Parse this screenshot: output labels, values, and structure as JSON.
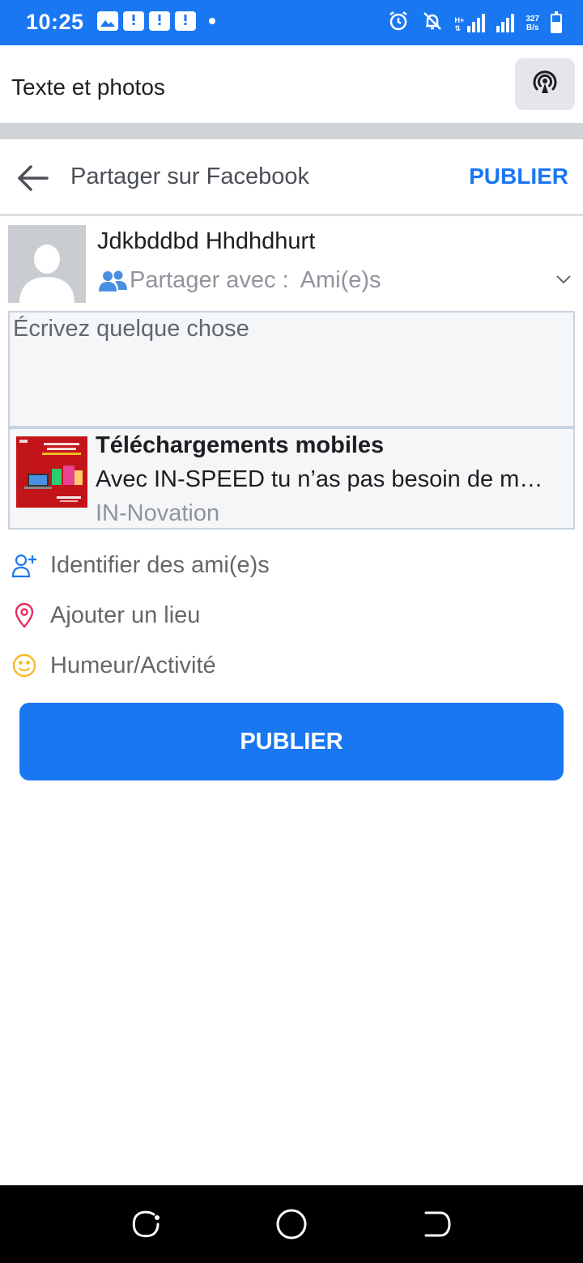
{
  "status_bar": {
    "time": "10:25",
    "network_type": "H+",
    "speed_value": "327",
    "speed_unit": "B/s",
    "notification_icons": [
      "image-icon",
      "message-alert-icon",
      "message-alert-icon",
      "message-alert-icon"
    ]
  },
  "app_bar": {
    "title": "Texte et photos",
    "action_icon": "broadcast-icon"
  },
  "header": {
    "back_icon": "arrow-left-icon",
    "title": "Partager sur Facebook",
    "publish_label": "PUBLIER"
  },
  "profile": {
    "name": "Jdkbddbd Hhdhdhurt",
    "audience_label": "Partager avec :",
    "audience_value": "Ami(e)s"
  },
  "composer": {
    "placeholder": "Écrivez quelque chose"
  },
  "link_preview": {
    "title": "Téléchargements mobiles",
    "description": "Avec IN-SPEED tu n’as pas besoin de m…",
    "source": "IN-Novation"
  },
  "actions": [
    {
      "label": "Identifier des ami(e)s",
      "icon": "add-friend-icon",
      "color": "#1a77f2"
    },
    {
      "label": "Ajouter un lieu",
      "icon": "location-pin-icon",
      "color": "#e42d5f"
    },
    {
      "label": "Humeur/Activité",
      "icon": "smiley-icon",
      "color": "#f7b928"
    }
  ],
  "publish_button": {
    "label": "PUBLIER"
  },
  "colors": {
    "accent": "#1a77f2",
    "status_bar": "#1a77f2"
  }
}
